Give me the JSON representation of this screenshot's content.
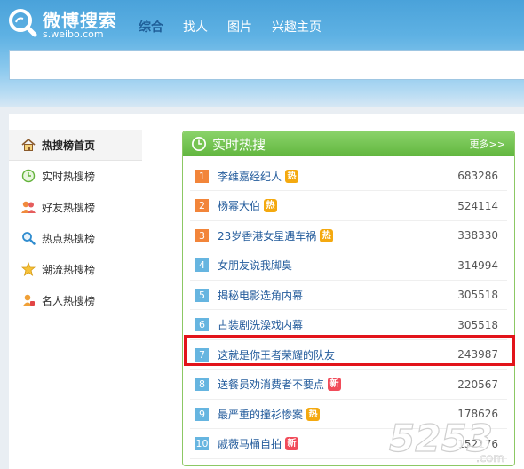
{
  "header": {
    "logo_text": "微博搜索",
    "logo_domain": "s.weibo.com",
    "nav": [
      "综合",
      "找人",
      "图片",
      "兴趣主页"
    ],
    "search_placeholder": ""
  },
  "sidebar": {
    "items": [
      {
        "label": "热搜榜首页",
        "icon": "home-icon"
      },
      {
        "label": "实时热搜榜",
        "icon": "clock-icon"
      },
      {
        "label": "好友热搜榜",
        "icon": "friends-icon"
      },
      {
        "label": "热点热搜榜",
        "icon": "magnifier-icon"
      },
      {
        "label": "潮流热搜榜",
        "icon": "star-icon"
      },
      {
        "label": "名人热搜榜",
        "icon": "celebrity-icon"
      }
    ]
  },
  "panel": {
    "title": "实时热搜",
    "more": "更多>>",
    "rows": [
      {
        "rank": "1",
        "title": "李维嘉经纪人",
        "badge": "热",
        "badge_type": "hot",
        "count": "683286"
      },
      {
        "rank": "2",
        "title": "杨幂大伯",
        "badge": "热",
        "badge_type": "hot",
        "count": "524114"
      },
      {
        "rank": "3",
        "title": "23岁香港女星遇车祸",
        "badge": "热",
        "badge_type": "hot",
        "count": "338330"
      },
      {
        "rank": "4",
        "title": "女朋友说我脚臭",
        "badge": "",
        "badge_type": "",
        "count": "314994"
      },
      {
        "rank": "5",
        "title": "揭秘电影选角内幕",
        "badge": "",
        "badge_type": "",
        "count": "305518"
      },
      {
        "rank": "6",
        "title": "古装剧洗澡戏内幕",
        "badge": "",
        "badge_type": "",
        "count": "305518"
      },
      {
        "rank": "7",
        "title": "这就是你王者荣耀的队友",
        "badge": "",
        "badge_type": "",
        "count": "243987"
      },
      {
        "rank": "8",
        "title": "送餐员劝消费者不要点",
        "badge": "新",
        "badge_type": "new",
        "count": "220567"
      },
      {
        "rank": "9",
        "title": "最严重的撞衫惨案",
        "badge": "热",
        "badge_type": "hot",
        "count": "178626"
      },
      {
        "rank": "10",
        "title": "戚薇马桶自拍",
        "badge": "新",
        "badge_type": "new",
        "count": "152176"
      }
    ]
  },
  "watermark": "5253.com",
  "colors": {
    "accent_blue": "#4aa2da",
    "panel_green": "#62b63f",
    "highlight_red": "#e2141a"
  }
}
